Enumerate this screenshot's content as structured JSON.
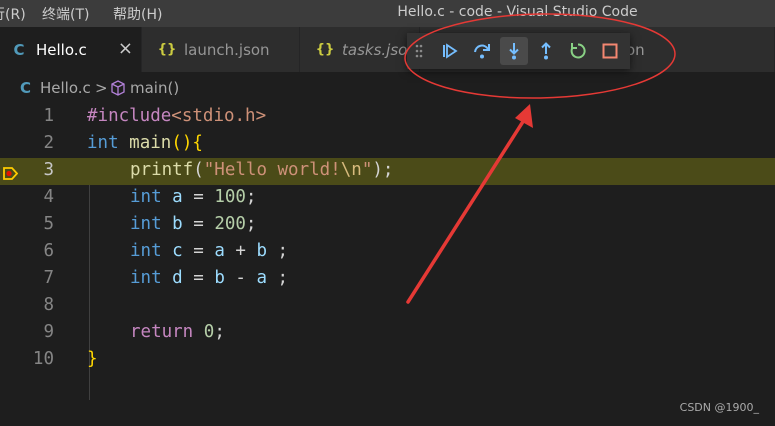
{
  "menu": [
    {
      "label": "行(R)"
    },
    {
      "label": "终端(T)"
    },
    {
      "label": "帮助(H)"
    }
  ],
  "window_title": "Hello.c - code - Visual Studio Code",
  "tabs": [
    {
      "label": "Hello.c",
      "icon": "c-file-icon",
      "active": true,
      "close": "×"
    },
    {
      "label": "launch.json",
      "icon": "json-file-icon",
      "active": false
    },
    {
      "label": "tasks.json",
      "icon": "json-file-icon",
      "active": false,
      "italic": true
    },
    {
      "label": "on",
      "icon": "",
      "active": false
    }
  ],
  "breadcrumb": {
    "file": "Hello.c",
    "separator": ">",
    "symbol": "main()"
  },
  "editor": {
    "current_line": 3,
    "lines": [
      {
        "num": "1",
        "text": "#include<stdio.h>"
      },
      {
        "num": "2",
        "text": "int main(){"
      },
      {
        "num": "3",
        "text": "    printf(\"Hello world!\\n\");"
      },
      {
        "num": "4",
        "text": "    int a = 100;"
      },
      {
        "num": "5",
        "text": "    int b = 200;"
      },
      {
        "num": "6",
        "text": "    int c = a + b ;"
      },
      {
        "num": "7",
        "text": "    int d = b - a ;"
      },
      {
        "num": "8",
        "text": ""
      },
      {
        "num": "9",
        "text": "    return 0;"
      },
      {
        "num": "10",
        "text": "}"
      }
    ]
  },
  "debug_toolbar": {
    "buttons": [
      {
        "name": "continue",
        "icon": "continue-icon",
        "color": "#75beff"
      },
      {
        "name": "step-over",
        "icon": "step-over-icon",
        "color": "#75beff"
      },
      {
        "name": "step-into",
        "icon": "step-into-icon",
        "color": "#75beff"
      },
      {
        "name": "step-out",
        "icon": "step-out-icon",
        "color": "#75beff"
      },
      {
        "name": "restart",
        "icon": "restart-icon",
        "color": "#89d185"
      },
      {
        "name": "stop",
        "icon": "stop-icon",
        "color": "#f48771"
      }
    ]
  },
  "annotation": {
    "color": "#e53935"
  },
  "watermark": "CSDN @1900_"
}
